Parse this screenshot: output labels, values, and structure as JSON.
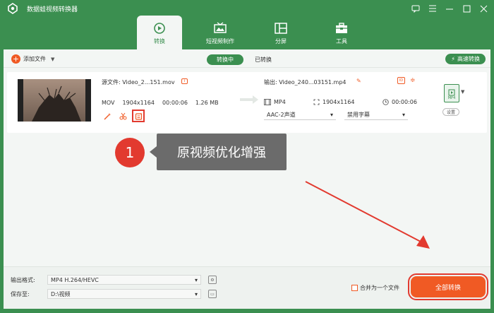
{
  "app": {
    "title": "数据蛙视频转换器"
  },
  "tabs": [
    {
      "label": "转换",
      "active": true,
      "icon": "convert-icon"
    },
    {
      "label": "短视频制作",
      "active": false,
      "icon": "tv-icon"
    },
    {
      "label": "分屏",
      "active": false,
      "icon": "split-screen-icon"
    },
    {
      "label": "工具",
      "active": false,
      "icon": "toolbox-icon"
    }
  ],
  "toolbar": {
    "add_file": "添加文件",
    "converting": "转换中",
    "converted": "已转换",
    "fast_convert": "高速转换"
  },
  "file": {
    "source": "源文件: Video_2...151.mov",
    "format": "MOV",
    "resolution": "1904x1164",
    "duration": "00:00:06",
    "size": "1.26 MB",
    "output": "输出: Video_240...03151.mp4",
    "out_format": "MP4",
    "out_resolution": "1904x1164",
    "out_duration": "00:00:06",
    "audio": "AAC-2声道",
    "subtitle": "禁用字幕",
    "format_tile": "MP4",
    "settings": "设置"
  },
  "callout": {
    "number": "1",
    "text": "原视频优化增强"
  },
  "bottom": {
    "output_format_label": "输出格式:",
    "output_format_value": "MP4 H.264/HEVC",
    "save_to_label": "保存至:",
    "save_to_value": "D:\\视频",
    "merge_label": "合并为一个文件",
    "convert_all": "全部转换"
  },
  "colors": {
    "brand": "#3b8f50",
    "accent": "#f05a24",
    "highlight": "#e23a2f"
  }
}
